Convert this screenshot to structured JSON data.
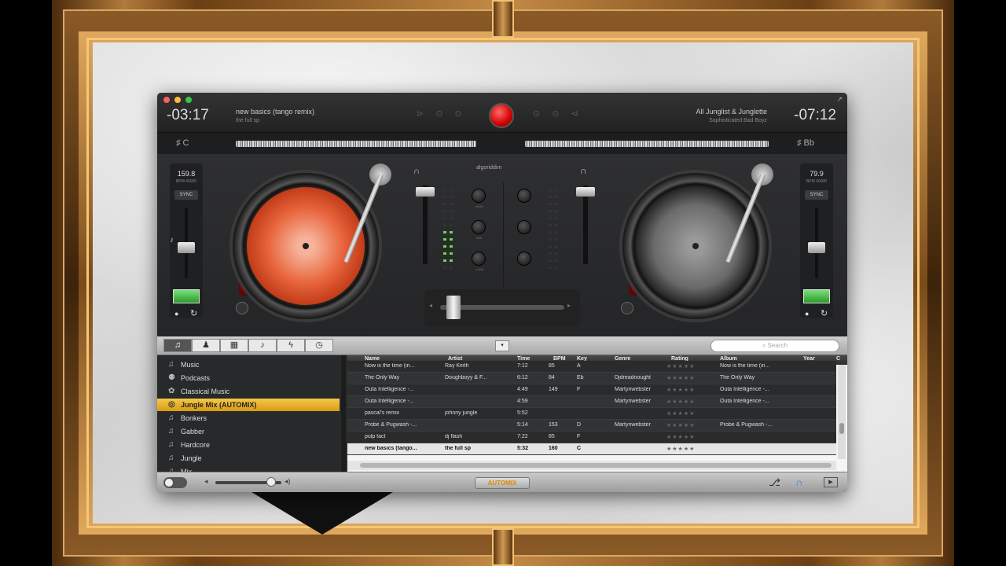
{
  "app": {
    "deck_left": {
      "time": "-03:17",
      "title": "new basics (tango remix)",
      "artist": "the full sp",
      "key": "♯ C",
      "bpm": "159.8",
      "bpm_sub": "BPM 40000",
      "sync": "SYNC"
    },
    "deck_right": {
      "time": "-07:12",
      "title": "All Junglist & Junglette",
      "artist": "Sophisticated Bad Boyz",
      "key": "♯ Bb",
      "bpm": "79.9",
      "bpm_sub": "BPM 40000",
      "sync": "SYNC"
    },
    "ghost_left": "⊳ ⊙ ⊙",
    "ghost_right": "⊙ ⊙ ⊲",
    "mixer_logo": "algoriddim",
    "knob_labels": [
      "HIGH",
      "MID",
      "LOW"
    ],
    "colors": {
      "accent": "#f5c84a",
      "record": "#d40000",
      "led_on": "#6cd84a"
    }
  },
  "tabs": [
    {
      "icon": "music-note-icon",
      "glyph": "♫"
    },
    {
      "icon": "user-icon",
      "glyph": "♟"
    },
    {
      "icon": "video-icon",
      "glyph": "▦"
    },
    {
      "icon": "guitar-icon",
      "glyph": "♪"
    },
    {
      "icon": "bolt-icon",
      "glyph": "ϟ"
    },
    {
      "icon": "clock-icon",
      "glyph": "◷"
    }
  ],
  "search": {
    "placeholder": "Search"
  },
  "dropdown_glyph": "▾",
  "sidebar": {
    "items": [
      {
        "label": "Music",
        "icon": "♫"
      },
      {
        "label": "Podcasts",
        "icon": "⚉"
      },
      {
        "label": "Classical Music",
        "icon": "✿"
      },
      {
        "label": "Jungle Mix (AUTOMIX)",
        "icon": "◎"
      },
      {
        "label": "Bonkers",
        "icon": "♫"
      },
      {
        "label": "Gabber",
        "icon": "♫"
      },
      {
        "label": "Hardcore",
        "icon": "♫"
      },
      {
        "label": "Jungle",
        "icon": "♫"
      },
      {
        "label": "Mix",
        "icon": "♫"
      }
    ],
    "selected_index": 3
  },
  "table": {
    "columns": [
      "Name",
      "Artist",
      "Time",
      "BPM",
      "Key",
      "Genre",
      "Rating",
      "Album",
      "Year",
      "C"
    ],
    "rows": [
      [
        "Now is the time (in...",
        "Ray Keith",
        "7:12",
        "85",
        "A",
        "",
        "★★★★★",
        "Now is the time (in..."
      ],
      [
        "The Only Way",
        "Doughboyy & F...",
        "6:12",
        "84",
        "Eb",
        "Djdreadnought",
        "★★★★★",
        "The Only Way"
      ],
      [
        "Outa Intelligence -...",
        "",
        "4:49",
        "149",
        "F",
        "Martynwebster",
        "★★★★★",
        "Outa Intelligence -..."
      ],
      [
        "Outa Intelligence -...",
        "",
        "4:59",
        "",
        "",
        "Martynwebster",
        "★★★★★",
        "Outa Intelligence -..."
      ],
      [
        "pascal's remix",
        "johnny jungle",
        "5:52",
        "",
        "",
        "",
        "★★★★★",
        ""
      ],
      [
        "Probe & Pugwash -...",
        "",
        "5:14",
        "153",
        "D",
        "Martynwebster",
        "★★★★★",
        "Probe & Pugwash -..."
      ],
      [
        "pulp fact",
        "dj flash",
        "7:22",
        "85",
        "F",
        "",
        "★★★★★",
        ""
      ],
      [
        "new basics (tango...",
        "the full sp",
        "5:32",
        "160",
        "C",
        "",
        "★★★★★",
        ""
      ]
    ],
    "playing_index": 7
  },
  "bottom": {
    "automix_label": "AUTOMIX",
    "volume_level": 0.85
  }
}
